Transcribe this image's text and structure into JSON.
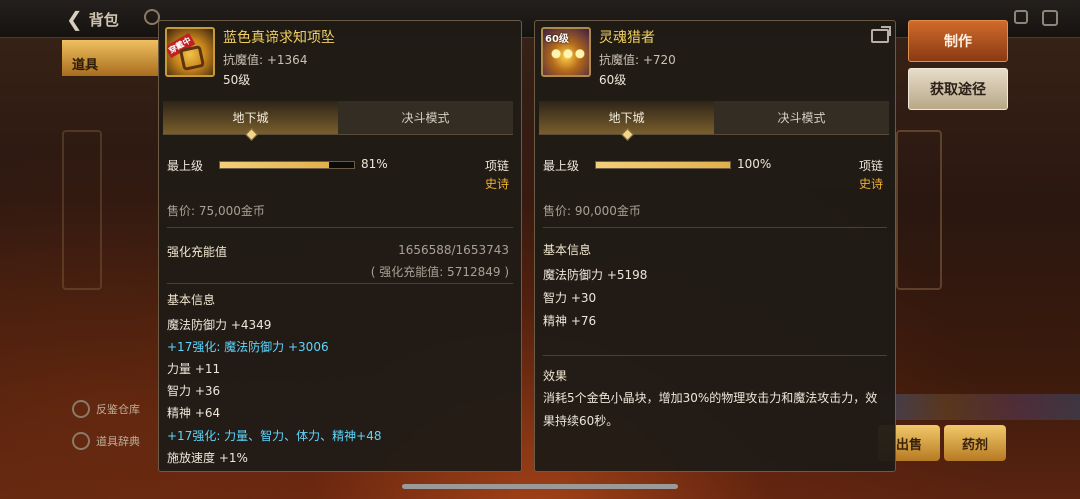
{
  "topbar": {
    "back_label": "背包",
    "side_tab_label": "道具"
  },
  "background": {
    "menu_items": [
      "反鉴仓库",
      "道具辞典"
    ],
    "bottom_buttons": [
      "出售",
      "药剂"
    ]
  },
  "left_item": {
    "icon_badge": "穿戴中",
    "name": "蓝色真谛求知项坠",
    "stat": "抗魔值: +1364",
    "level": "50级",
    "tabs": [
      "地下城",
      "决斗模式"
    ],
    "active_tab": 0,
    "grade_label": "最上级",
    "grade_percent": 81,
    "grade_percent_text": "81%",
    "slot_type": "项链",
    "rarity": "史诗",
    "price": "售价: 75,000金币",
    "enhance_label": "强化充能值",
    "enhance_value": "1656588/1653743",
    "enhance_detail": "( 强化充能值: 5712849 )",
    "basic_info_title": "基本信息",
    "stats": [
      {
        "text": "魔法防御力 +4349",
        "style": "normal"
      },
      {
        "text": "+17强化: 魔法防御力 +3006",
        "style": "cyan"
      },
      {
        "text": "力量 +11",
        "style": "normal"
      },
      {
        "text": "智力 +36",
        "style": "normal"
      },
      {
        "text": "精神 +64",
        "style": "normal"
      },
      {
        "text": "+17强化: 力量、智力、体力、精神+48",
        "style": "cyan"
      },
      {
        "text": "施放速度 +1%",
        "style": "normal"
      }
    ]
  },
  "right_item": {
    "icon_level": "60级",
    "name": "灵魂猎者",
    "stat": "抗魔值: +720",
    "level": "60级",
    "tabs": [
      "地下城",
      "决斗模式"
    ],
    "active_tab": 0,
    "grade_label": "最上级",
    "grade_percent": 100,
    "grade_percent_text": "100%",
    "slot_type": "项链",
    "rarity": "史诗",
    "price": "售价: 90,000金币",
    "basic_info_title": "基本信息",
    "stats": [
      {
        "text": "魔法防御力 +5198",
        "style": "normal"
      },
      {
        "text": "智力 +30",
        "style": "normal"
      },
      {
        "text": "精神 +76",
        "style": "normal"
      }
    ],
    "effect_title": "效果",
    "effect_text": "消耗5个金色小晶块，增加30%的物理攻击力和魔法攻击力，效果持续60秒。"
  },
  "actions": {
    "craft_label": "制作",
    "source_label": "获取途径"
  },
  "colors": {
    "item_name": "#f0d060",
    "rarity_epic": "#f0b030",
    "enhance_cyan": "#5cd6ff",
    "primary_button": "#d06a2c"
  }
}
